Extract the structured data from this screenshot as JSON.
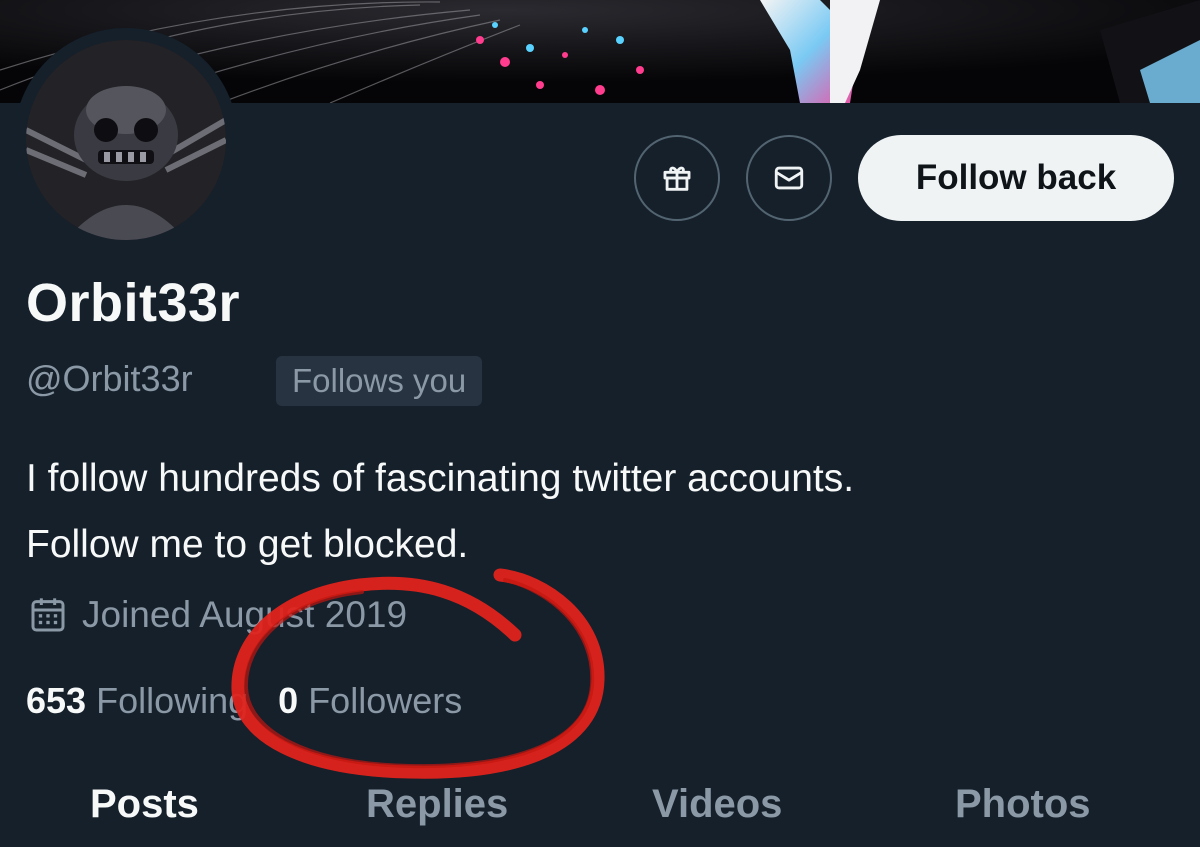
{
  "profile": {
    "display_name": "Orbit33r",
    "handle": "@Orbit33r",
    "follows_you_badge": "Follows you",
    "bio_lines": [
      "I follow hundreds of fascinating twitter accounts.",
      "Follow me to get blocked."
    ],
    "joined": "Joined August 2019",
    "following_count": "653",
    "following_label": "Following",
    "followers_count": "0",
    "followers_label": "Followers"
  },
  "actions": {
    "gift_icon": "gift-icon",
    "message_icon": "envelope-icon",
    "follow_back_label": "Follow back"
  },
  "tabs": [
    {
      "label": "Posts",
      "active": true
    },
    {
      "label": "Replies",
      "active": false
    },
    {
      "label": "Videos",
      "active": false
    },
    {
      "label": "Photos",
      "active": false
    }
  ],
  "colors": {
    "background": "#15202b",
    "primary_text": "#f7f9f9",
    "secondary_text": "#8b98a5",
    "button_bg": "#eff3f4",
    "annotation_red": "#e0231b"
  }
}
